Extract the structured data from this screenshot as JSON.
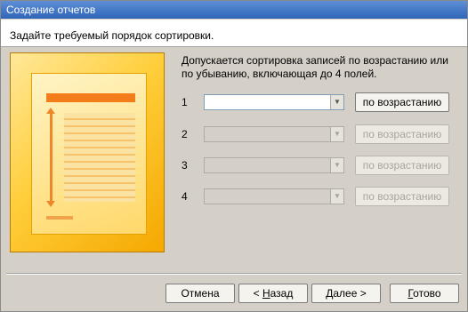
{
  "window": {
    "title": "Создание отчетов"
  },
  "header": {
    "prompt": "Задайте требуемый порядок сортировки."
  },
  "description": "Допускается сортировка записей по возрастанию или по убыванию, включающая до 4 полей.",
  "sort_rows": [
    {
      "num": "1",
      "value": "",
      "order": "по возрастанию",
      "enabled": true
    },
    {
      "num": "2",
      "value": "",
      "order": "по возрастанию",
      "enabled": false
    },
    {
      "num": "3",
      "value": "",
      "order": "по возрастанию",
      "enabled": false
    },
    {
      "num": "4",
      "value": "",
      "order": "по возрастанию",
      "enabled": false
    }
  ],
  "buttons": {
    "cancel": "Отмена",
    "back_prefix": "< ",
    "back_accel": "Н",
    "back_rest": "азад",
    "next_prefix": "",
    "next_accel": "Д",
    "next_rest": "алее >",
    "finish_accel": "Г",
    "finish_rest": "отово"
  }
}
